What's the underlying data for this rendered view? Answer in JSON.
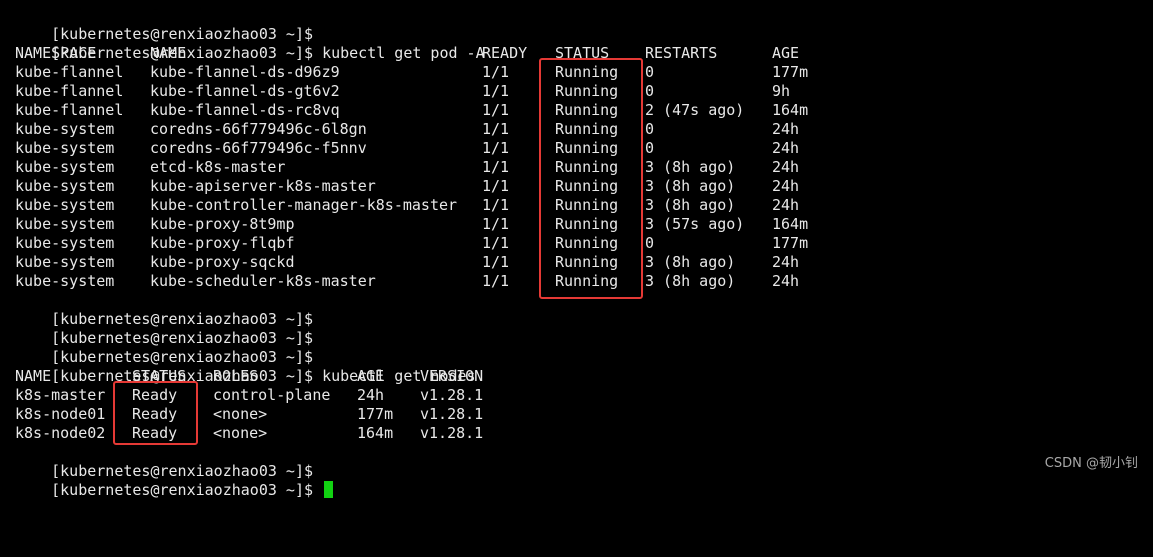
{
  "prompt": "[kubernetes@renxiaozhao03 ~]$",
  "commands": {
    "first": "",
    "get_pod": "kubectl get pod -A",
    "get_nodes": "kubectl get nodes"
  },
  "pods": {
    "headers": [
      "NAMESPACE",
      "NAME",
      "READY",
      "STATUS",
      "RESTARTS",
      "AGE"
    ],
    "rows": [
      [
        "kube-flannel",
        "kube-flannel-ds-d96z9",
        "1/1",
        "Running",
        "0",
        "177m"
      ],
      [
        "kube-flannel",
        "kube-flannel-ds-gt6v2",
        "1/1",
        "Running",
        "0",
        "9h"
      ],
      [
        "kube-flannel",
        "kube-flannel-ds-rc8vq",
        "1/1",
        "Running",
        "2 (47s ago)",
        "164m"
      ],
      [
        "kube-system",
        "coredns-66f779496c-6l8gn",
        "1/1",
        "Running",
        "0",
        "24h"
      ],
      [
        "kube-system",
        "coredns-66f779496c-f5nnv",
        "1/1",
        "Running",
        "0",
        "24h"
      ],
      [
        "kube-system",
        "etcd-k8s-master",
        "1/1",
        "Running",
        "3 (8h ago)",
        "24h"
      ],
      [
        "kube-system",
        "kube-apiserver-k8s-master",
        "1/1",
        "Running",
        "3 (8h ago)",
        "24h"
      ],
      [
        "kube-system",
        "kube-controller-manager-k8s-master",
        "1/1",
        "Running",
        "3 (8h ago)",
        "24h"
      ],
      [
        "kube-system",
        "kube-proxy-8t9mp",
        "1/1",
        "Running",
        "3 (57s ago)",
        "164m"
      ],
      [
        "kube-system",
        "kube-proxy-flqbf",
        "1/1",
        "Running",
        "0",
        "177m"
      ],
      [
        "kube-system",
        "kube-proxy-sqckd",
        "1/1",
        "Running",
        "3 (8h ago)",
        "24h"
      ],
      [
        "kube-system",
        "kube-scheduler-k8s-master",
        "1/1",
        "Running",
        "3 (8h ago)",
        "24h"
      ]
    ]
  },
  "nodes": {
    "headers": [
      "NAME",
      "STATUS",
      "ROLES",
      "AGE",
      "VERSION"
    ],
    "rows": [
      [
        "k8s-master",
        "Ready",
        "control-plane",
        "24h",
        "v1.28.1"
      ],
      [
        "k8s-node01",
        "Ready",
        "<none>",
        "177m",
        "v1.28.1"
      ],
      [
        "k8s-node02",
        "Ready",
        "<none>",
        "164m",
        "v1.28.1"
      ]
    ]
  },
  "colors": {
    "background": "#000000",
    "text": "#e8e8e8",
    "cursor": "#12d212",
    "highlight_box": "#e53935",
    "watermark": "#a8a8a8"
  },
  "watermark": "CSDN @韧小钊"
}
